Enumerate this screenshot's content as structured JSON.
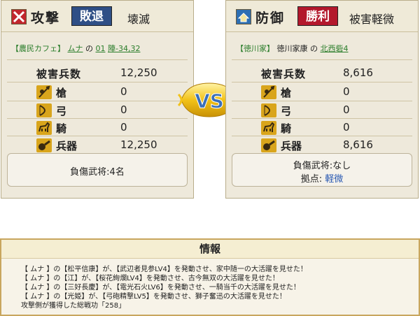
{
  "attack": {
    "role": "攻撃",
    "outcome": "敗退",
    "outcome_color": "#2f4f86",
    "result": "壊滅",
    "location": {
      "alliance": "【農民カフェ】",
      "player": "ムナ",
      "particle": "の",
      "place": "01",
      "coords": "陣-34,32"
    },
    "damage_label": "被害兵数",
    "damage_value": "12,250",
    "units": [
      {
        "icon": "spear-icon",
        "label": "槍",
        "value": "0"
      },
      {
        "icon": "bow-icon",
        "label": "弓",
        "value": "0"
      },
      {
        "icon": "horse-icon",
        "label": "騎",
        "value": "0"
      },
      {
        "icon": "weapon-icon",
        "label": "兵器",
        "value": "12,250"
      }
    ],
    "summary_line1": "負傷武将:4名",
    "summary_line2_label": "",
    "summary_line2_value": ""
  },
  "defense": {
    "role": "防御",
    "outcome": "勝利",
    "outcome_color": "#b3182c",
    "result": "被害軽微",
    "location": {
      "alliance": "【徳川家】",
      "player": "徳川家康",
      "particle": "の",
      "place": "北西砦4"
    },
    "damage_label": "被害兵数",
    "damage_value": "8,616",
    "units": [
      {
        "icon": "spear-icon",
        "label": "槍",
        "value": "0"
      },
      {
        "icon": "bow-icon",
        "label": "弓",
        "value": "0"
      },
      {
        "icon": "horse-icon",
        "label": "騎",
        "value": "0"
      },
      {
        "icon": "weapon-icon",
        "label": "兵器",
        "value": "8,616"
      }
    ],
    "summary_line1": "負傷武将:なし",
    "summary_line2_label": "拠点:",
    "summary_line2_value": "軽微"
  },
  "vs_text": "VS",
  "info": {
    "title": "情報",
    "log": [
      "【 ムナ 】の【松平信康】が、【武辺者見参LV4】を発動させ、家中随一の大活躍を見せた！",
      "【 ムナ 】の【江】が、【桜花絢爛LV4】を発動させ、古今無双の大活躍を見せた！",
      "【 ムナ 】の【三好長慶】が、【電光石火LV6】を発動させ、一騎当千の大活躍を見せた！",
      "【 ムナ 】の【光姫】が、【弓砲精撃LV5】を発動させ、獅子奮迅の大活躍を見せた！",
      "攻撃側が獲得した総戦功「258」"
    ]
  }
}
